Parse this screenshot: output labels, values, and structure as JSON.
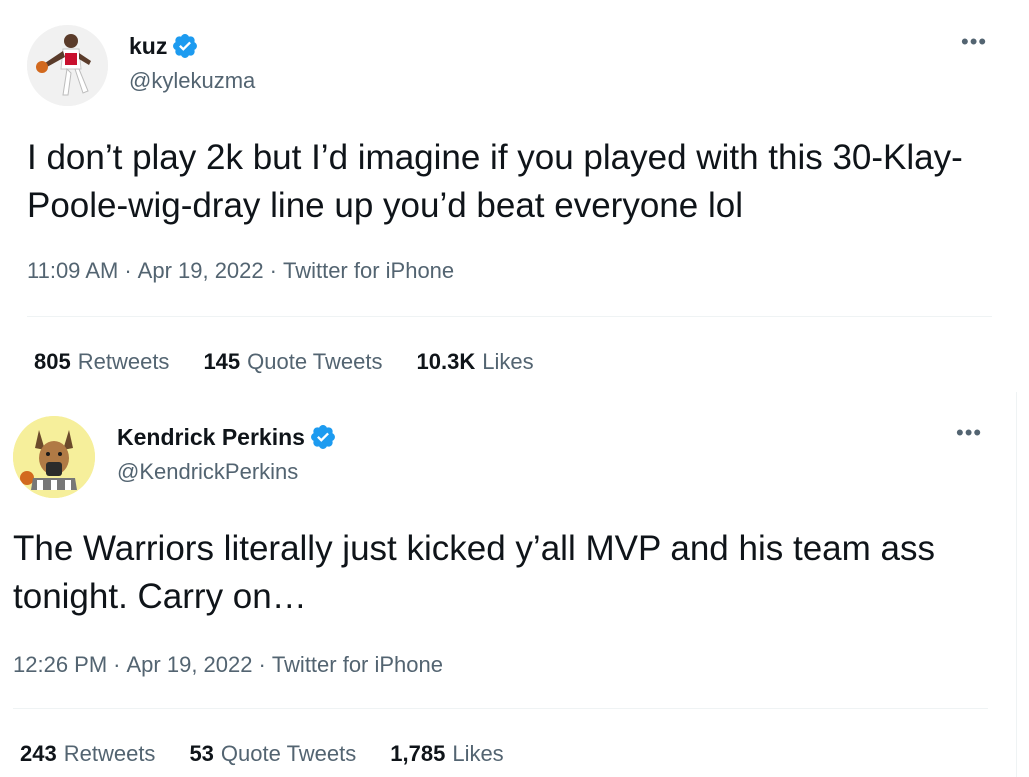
{
  "tweets": [
    {
      "display_name": "kuz",
      "handle": "@kylekuzma",
      "text": "I don’t play 2k but I’d imagine if you played with this 30-Klay-Poole-wig-dray line up you’d beat everyone lol",
      "time": "11:09 AM",
      "date": "Apr 19, 2022",
      "source": "Twitter for iPhone",
      "separator": "·",
      "more": "•••",
      "stats": [
        {
          "value": "805",
          "label": "Retweets"
        },
        {
          "value": "145",
          "label": "Quote Tweets"
        },
        {
          "value": "10.3K",
          "label": "Likes"
        }
      ]
    },
    {
      "display_name": "Kendrick Perkins",
      "handle": "@KendrickPerkins",
      "text": "The Warriors literally just kicked y’all MVP and his team ass tonight. Carry on…",
      "time": "12:26 PM",
      "date": "Apr 19, 2022",
      "source": "Twitter for iPhone",
      "separator": "·",
      "more": "•••",
      "stats": [
        {
          "value": "243",
          "label": "Retweets"
        },
        {
          "value": "53",
          "label": "Quote Tweets"
        },
        {
          "value": "1,785",
          "label": "Likes"
        }
      ]
    }
  ],
  "icons": {
    "verified": "verified-badge-icon",
    "more": "more-options-icon"
  },
  "colors": {
    "text": "#0f1419",
    "secondary": "#536471",
    "verified": "#1d9bf0",
    "divider": "#eff3f4"
  }
}
